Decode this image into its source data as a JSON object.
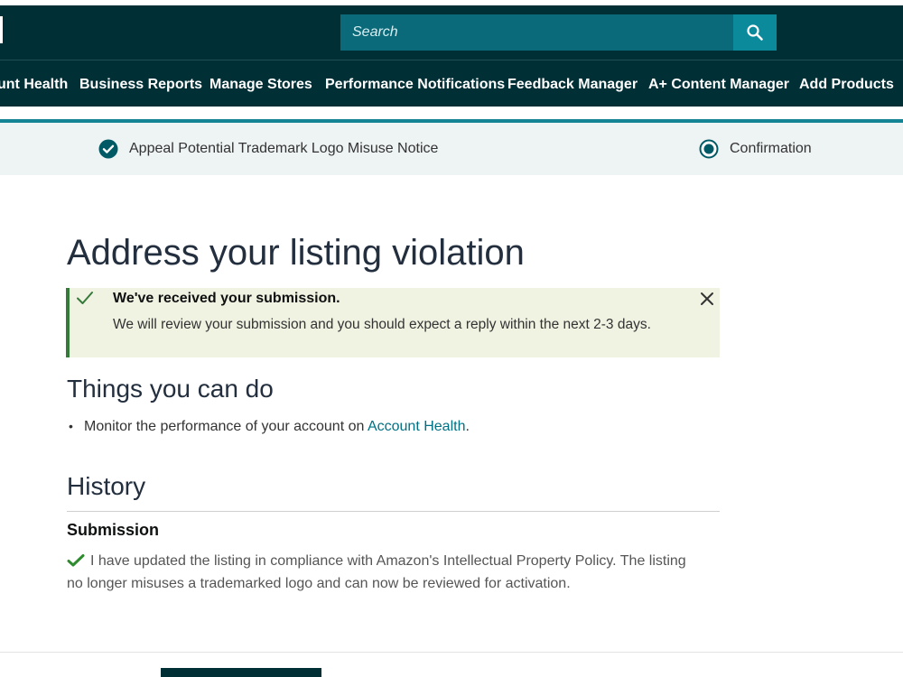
{
  "header": {
    "search": {
      "placeholder": "Search"
    }
  },
  "nav": {
    "items": [
      {
        "label": "unt Health"
      },
      {
        "label": "Business Reports"
      },
      {
        "label": "Manage Stores"
      },
      {
        "label": "Performance Notifications"
      },
      {
        "label": "Feedback Manager"
      },
      {
        "label": "A+ Content Manager"
      },
      {
        "label": "Add Products"
      }
    ]
  },
  "steps": [
    {
      "label": "Appeal Potential Trademark Logo Misuse Notice",
      "state": "completed"
    },
    {
      "label": "Confirmation",
      "state": "current"
    }
  ],
  "page": {
    "title": "Address your listing violation"
  },
  "alert": {
    "title": "We've received your submission.",
    "body": "We will review your submission and you should expect a reply within the next 2-3 days."
  },
  "things": {
    "heading": "Things you can do",
    "bullet_prefix": "Monitor the performance of your account on ",
    "bullet_link": "Account Health",
    "bullet_suffix": "."
  },
  "history": {
    "heading": "History",
    "submission_title": "Submission",
    "submission_text": "I have updated the listing in compliance with Amazon's Intellectual Property Policy. The listing no longer misuses a trademarked logo and can now be reviewed for activation."
  },
  "colors": {
    "header_bg": "#002f36",
    "accent_teal": "#128493",
    "alert_bg": "#f0f2e2",
    "success_green": "#357a38",
    "link": "#007185"
  },
  "icons": {
    "search": "search-icon",
    "step_done": "check-circle-icon",
    "step_current": "radio-dot-icon",
    "alert": "checkmark-icon",
    "close": "close-icon",
    "submission": "green-check-icon"
  }
}
